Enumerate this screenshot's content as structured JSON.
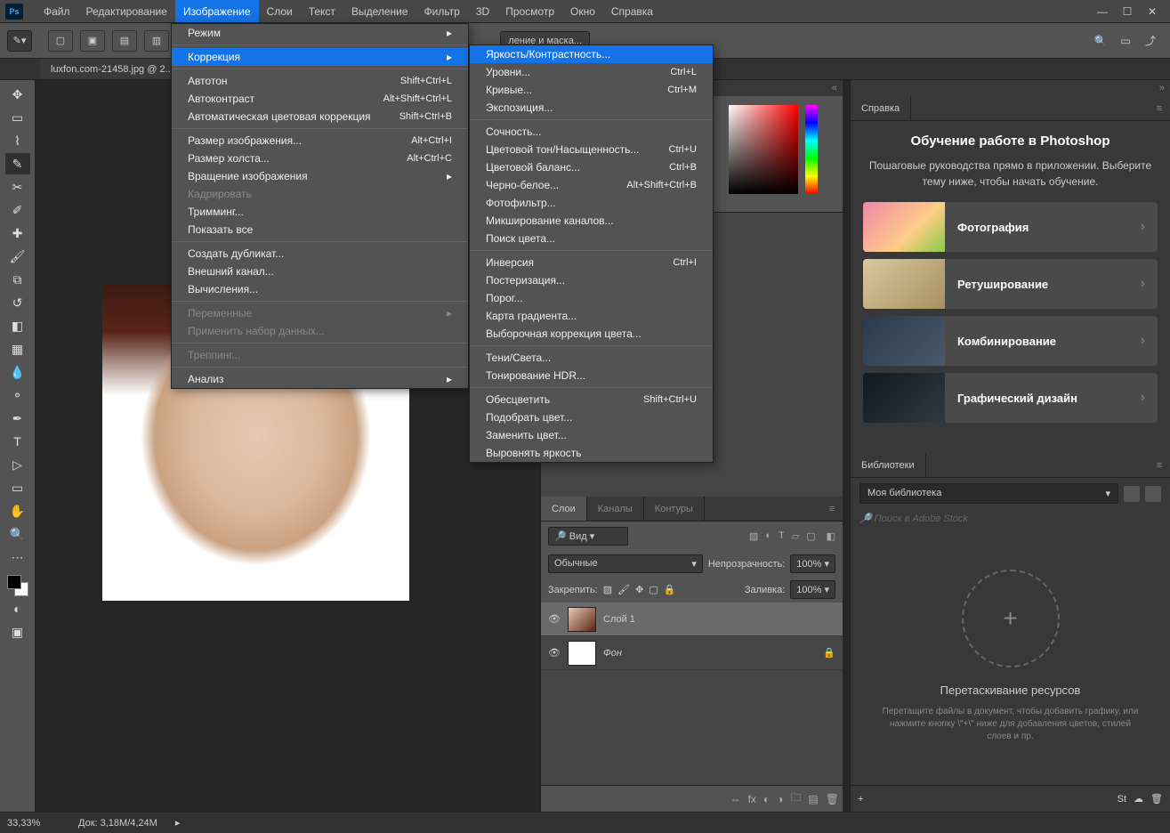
{
  "menubar": [
    "Файл",
    "Редактирование",
    "Изображение",
    "Слои",
    "Текст",
    "Выделение",
    "Фильтр",
    "3D",
    "Просмотр",
    "Окно",
    "Справка"
  ],
  "doctab": "luxfon.com-21458.jpg @ 2...",
  "opt_mask": "ление и маска...",
  "image_menu": [
    {
      "t": "Режим",
      "arrow": true
    },
    {
      "sep": true
    },
    {
      "t": "Коррекция",
      "arrow": true,
      "hl": true
    },
    {
      "sep": true
    },
    {
      "t": "Автотон",
      "s": "Shift+Ctrl+L"
    },
    {
      "t": "Автоконтраст",
      "s": "Alt+Shift+Ctrl+L"
    },
    {
      "t": "Автоматическая цветовая коррекция",
      "s": "Shift+Ctrl+B"
    },
    {
      "sep": true
    },
    {
      "t": "Размер изображения...",
      "s": "Alt+Ctrl+I"
    },
    {
      "t": "Размер холста...",
      "s": "Alt+Ctrl+C"
    },
    {
      "t": "Вращение изображения",
      "arrow": true
    },
    {
      "t": "Кадрировать",
      "disabled": true
    },
    {
      "t": "Тримминг..."
    },
    {
      "t": "Показать все"
    },
    {
      "sep": true
    },
    {
      "t": "Создать дубликат..."
    },
    {
      "t": "Внешний канал..."
    },
    {
      "t": "Вычисления..."
    },
    {
      "sep": true
    },
    {
      "t": "Переменные",
      "arrow": true,
      "disabled": true
    },
    {
      "t": "Применить набор данных...",
      "disabled": true
    },
    {
      "sep": true
    },
    {
      "t": "Треппинг...",
      "disabled": true
    },
    {
      "sep": true
    },
    {
      "t": "Анализ",
      "arrow": true
    }
  ],
  "corr_menu": [
    {
      "t": "Яркость/Контрастность...",
      "hl": true
    },
    {
      "t": "Уровни...",
      "s": "Ctrl+L"
    },
    {
      "t": "Кривые...",
      "s": "Ctrl+M"
    },
    {
      "t": "Экспозиция..."
    },
    {
      "sep": true
    },
    {
      "t": "Сочность..."
    },
    {
      "t": "Цветовой тон/Насыщенность...",
      "s": "Ctrl+U"
    },
    {
      "t": "Цветовой баланс...",
      "s": "Ctrl+B"
    },
    {
      "t": "Черно-белое...",
      "s": "Alt+Shift+Ctrl+B"
    },
    {
      "t": "Фотофильтр..."
    },
    {
      "t": "Микширование каналов..."
    },
    {
      "t": "Поиск цвета..."
    },
    {
      "sep": true
    },
    {
      "t": "Инверсия",
      "s": "Ctrl+I"
    },
    {
      "t": "Постеризация..."
    },
    {
      "t": "Порог..."
    },
    {
      "t": "Карта градиента..."
    },
    {
      "t": "Выборочная коррекция цвета..."
    },
    {
      "sep": true
    },
    {
      "t": "Тени/Света..."
    },
    {
      "t": "Тонирование HDR..."
    },
    {
      "sep": true
    },
    {
      "t": "Обесцветить",
      "s": "Shift+Ctrl+U"
    },
    {
      "t": "Подобрать цвет..."
    },
    {
      "t": "Заменить цвет..."
    },
    {
      "t": "Выровнять яркость"
    }
  ],
  "learn": {
    "tab": "Справка",
    "title": "Обучение работе в Photoshop",
    "sub": "Пошаговые руководства прямо в приложении. Выберите тему ниже, чтобы начать обучение.",
    "cards": [
      "Фотография",
      "Ретуширование",
      "Комбинирование",
      "Графический дизайн"
    ]
  },
  "lib": {
    "tab": "Библиотеки",
    "dd": "Моя библиотека",
    "search": "Поиск в Adobe Stock",
    "drop_title": "Перетаскивание ресурсов",
    "drop_desc": "Перетащите файлы в документ, чтобы добавить графику, или нажмите кнопку \\\"+\\\" ниже для добавления цветов, стилей слоев и пр."
  },
  "layers": {
    "tabs": [
      "Слои",
      "Каналы",
      "Контуры"
    ],
    "kind": "Вид",
    "blend": "Обычные",
    "opacity_lbl": "Непрозрачность:",
    "opacity": "100%",
    "lock_lbl": "Закрепить:",
    "fill_lbl": "Заливка:",
    "fill": "100%",
    "items": [
      {
        "name": "Слой 1",
        "sel": true,
        "italic": false
      },
      {
        "name": "Фон",
        "sel": false,
        "italic": true,
        "locked": true
      }
    ]
  },
  "status": {
    "zoom": "33,33%",
    "doc": "Док: 3,18M/4,24M"
  }
}
